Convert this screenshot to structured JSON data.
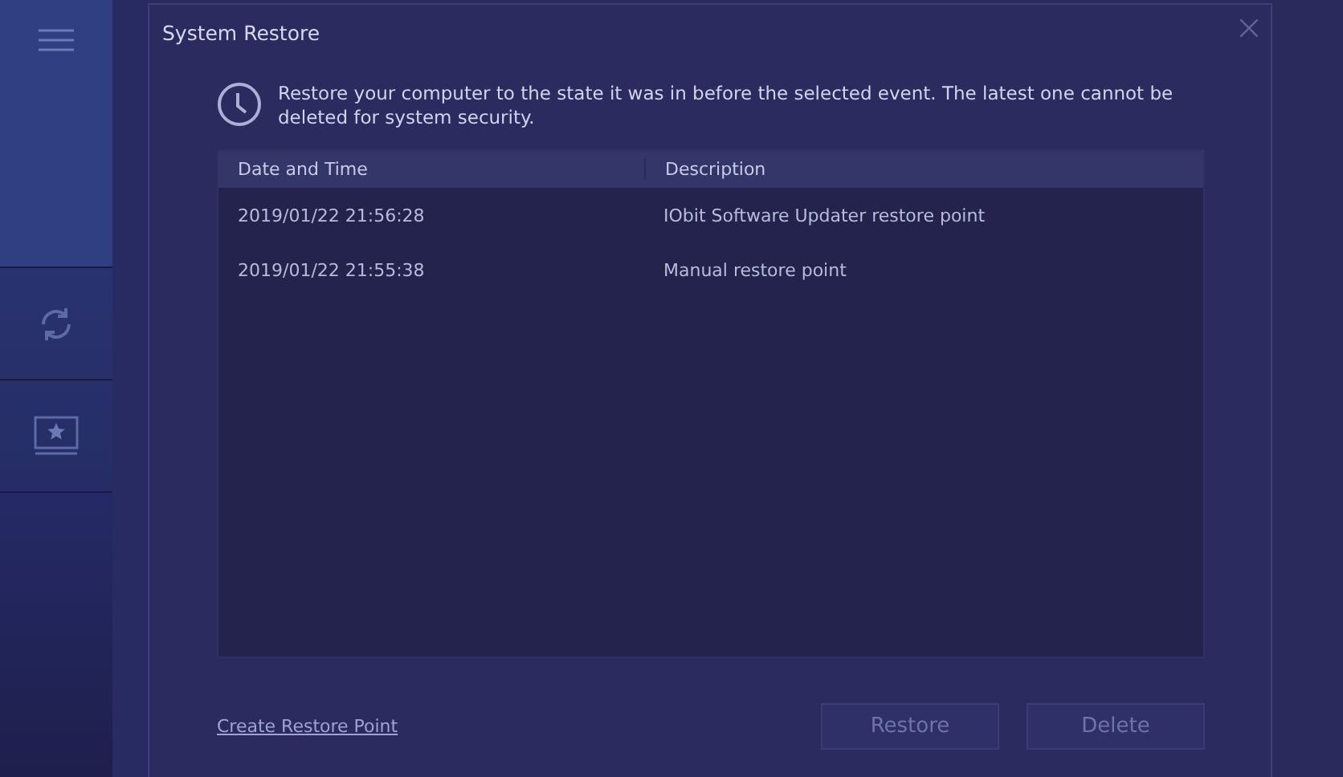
{
  "sidebar": {
    "items": [
      {
        "kind": "menu"
      },
      {
        "kind": "refresh"
      },
      {
        "kind": "monitor-star"
      }
    ]
  },
  "dialog": {
    "title": "System Restore",
    "message": "Restore your computer to the state it was in before the selected event. The latest one cannot be deleted for system security.",
    "table": {
      "columns": [
        "Date and Time",
        "Description"
      ],
      "rows": [
        {
          "cells": [
            "2019/01/22 21:56:28",
            "IObit Software Updater restore point"
          ],
          "selected": false
        },
        {
          "cells": [
            "2019/01/22 21:55:38",
            "Manual restore point"
          ],
          "selected": false
        }
      ]
    },
    "link": "Create Restore Point",
    "buttons": [
      {
        "label": "Restore",
        "disabled": true
      },
      {
        "label": "Delete",
        "disabled": true
      }
    ]
  }
}
